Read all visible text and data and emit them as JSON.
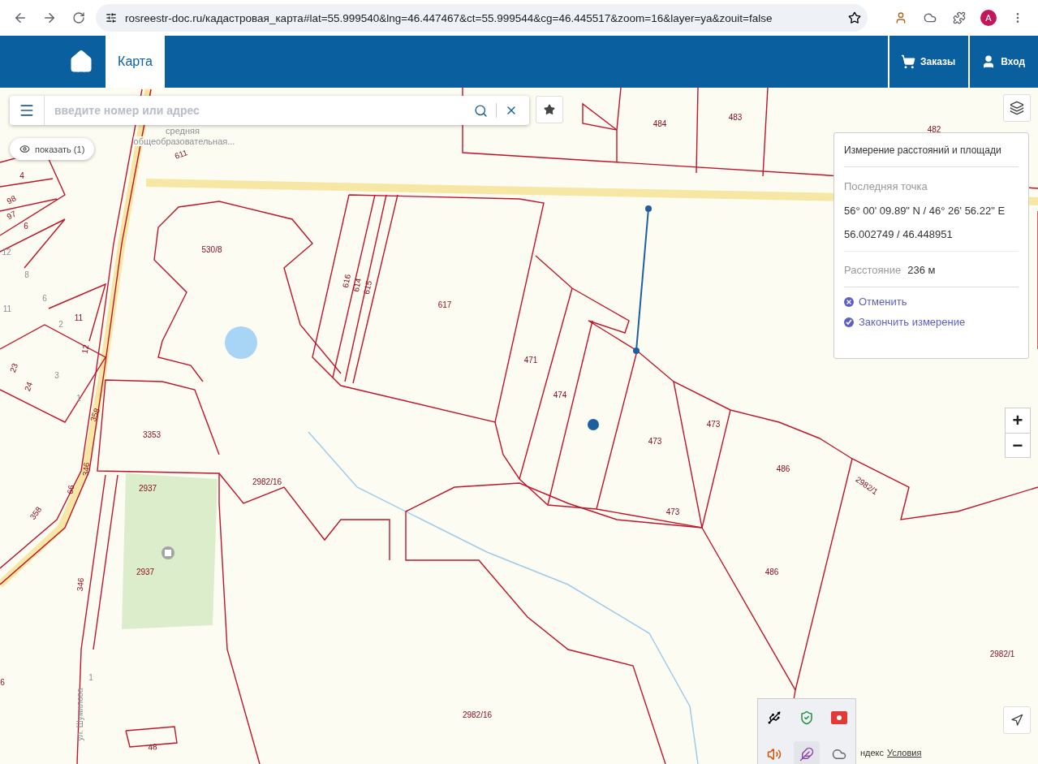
{
  "browser": {
    "url": "rosreestr-doc.ru/кадастровая_карта#lat=55.999540&lng=46.447467&ct=55.999544&cg=46.445517&zoom=16&layer=ya&zouit=false",
    "profile_initial": "A"
  },
  "header": {
    "nav": [
      {
        "label": "Карта",
        "selected": true
      }
    ],
    "actions": [
      {
        "label": "Заказы",
        "kind": "cart"
      },
      {
        "label": "Вход",
        "kind": "user"
      }
    ]
  },
  "search": {
    "placeholder": "введите номер или адрес"
  },
  "show_button": "показать (1)",
  "measure_panel": {
    "title": "Измерение расстояний и площади",
    "last_point_label": "Последняя точка",
    "dms": "56° 00' 09.89\" N / 46° 26' 56.22\" E",
    "decimal": "56.002749 / 46.448951",
    "distance_label": "Расстояние",
    "distance_value": "236 м",
    "actions": [
      {
        "label": "Отменить",
        "kind": "cancel"
      },
      {
        "label": "Закончить измерение",
        "kind": "finish"
      }
    ]
  },
  "zoom": [
    "+",
    "−"
  ],
  "map_labels": [
    {
      "text": "484",
      "kind": "parcel"
    },
    {
      "text": "483",
      "kind": "parcel"
    },
    {
      "text": "482",
      "kind": "parcel"
    },
    {
      "text": "617",
      "kind": "parcel"
    },
    {
      "text": "616",
      "kind": "parcel"
    },
    {
      "text": "614",
      "kind": "parcel"
    },
    {
      "text": "615",
      "kind": "parcel"
    },
    {
      "text": "471",
      "kind": "parcel"
    },
    {
      "text": "474",
      "kind": "parcel"
    },
    {
      "text": "473",
      "kind": "parcel"
    },
    {
      "text": "473",
      "kind": "parcel"
    },
    {
      "text": "473",
      "kind": "parcel"
    },
    {
      "text": "486",
      "kind": "parcel"
    },
    {
      "text": "486",
      "kind": "parcel"
    },
    {
      "text": "2982/1",
      "kind": "parcel"
    },
    {
      "text": "2982/1",
      "kind": "parcel"
    },
    {
      "text": "2982/16",
      "kind": "parcel"
    },
    {
      "text": "2982/16",
      "kind": "parcel"
    },
    {
      "text": "530/8",
      "kind": "parcel"
    },
    {
      "text": "3353",
      "kind": "parcel"
    },
    {
      "text": "2937",
      "kind": "parcel"
    },
    {
      "text": "2937",
      "kind": "parcel"
    },
    {
      "text": "611",
      "kind": "parcel"
    },
    {
      "text": "4",
      "kind": "parcel"
    },
    {
      "text": "98",
      "kind": "parcel"
    },
    {
      "text": "97",
      "kind": "parcel"
    },
    {
      "text": "6",
      "kind": "parcel"
    },
    {
      "text": "12",
      "kind": "house"
    },
    {
      "text": "8",
      "kind": "house"
    },
    {
      "text": "6",
      "kind": "house"
    },
    {
      "text": "11",
      "kind": "house"
    },
    {
      "text": "11",
      "kind": "parcel"
    },
    {
      "text": "2",
      "kind": "house"
    },
    {
      "text": "12",
      "kind": "parcel"
    },
    {
      "text": "23",
      "kind": "parcel"
    },
    {
      "text": "24",
      "kind": "parcel"
    },
    {
      "text": "3",
      "kind": "house"
    },
    {
      "text": "1",
      "kind": "house"
    },
    {
      "text": "358",
      "kind": "parcel"
    },
    {
      "text": "346",
      "kind": "parcel"
    },
    {
      "text": "66",
      "kind": "parcel"
    },
    {
      "text": "358",
      "kind": "parcel"
    },
    {
      "text": "346",
      "kind": "parcel"
    },
    {
      "text": "1",
      "kind": "house"
    },
    {
      "text": "ул. Шумилова",
      "kind": "street"
    },
    {
      "text": "48",
      "kind": "parcel"
    },
    {
      "text": "средняя",
      "kind": "poi"
    },
    {
      "text": "общеобразовательная...",
      "kind": "poi"
    },
    {
      "text": "6",
      "kind": "parcel"
    }
  ],
  "attribution": {
    "brand": "ндекс",
    "link": "Условия"
  }
}
